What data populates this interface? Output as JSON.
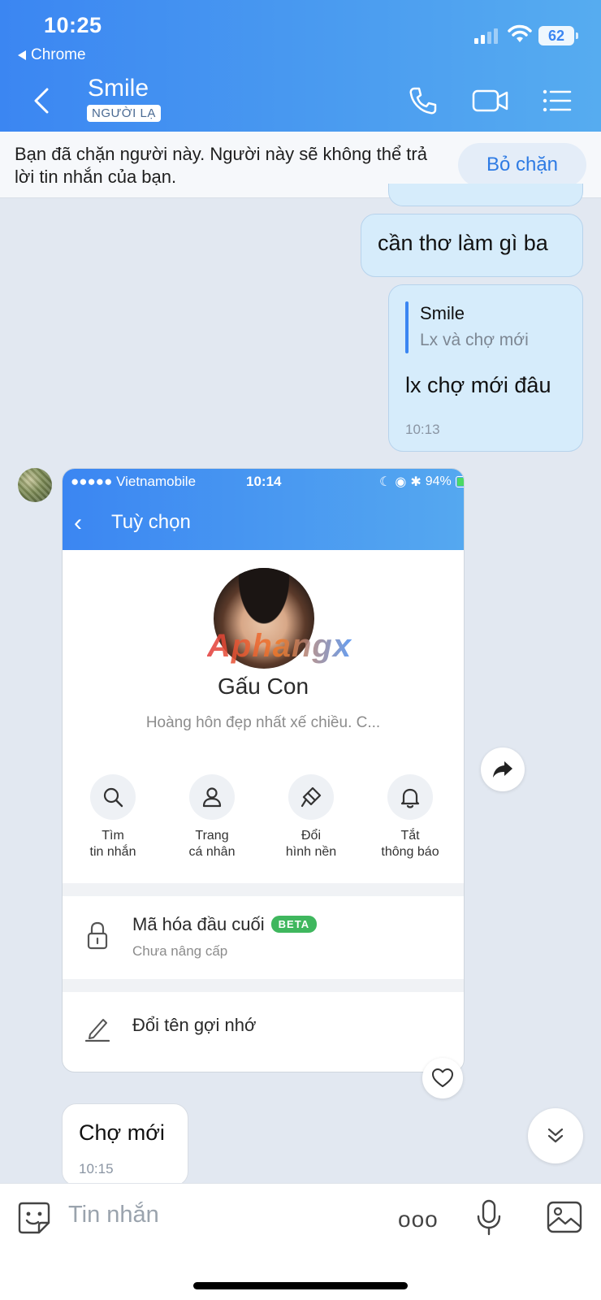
{
  "status_bar": {
    "time": "10:25",
    "back_app": "Chrome",
    "battery": "62"
  },
  "header": {
    "title": "Smile",
    "badge": "NGƯỜI LẠ",
    "icons": [
      "back-icon",
      "phone-icon",
      "video-icon",
      "list-menu-icon"
    ]
  },
  "block_banner": {
    "text": "Bạn đã chặn người này. Người này sẽ không thể trả lời tin nhắn của bạn.",
    "unblock_label": "Bỏ chặn"
  },
  "messages": {
    "out1": {
      "text": "cần thơ làm gì ba"
    },
    "out2": {
      "quote_author": "Smile",
      "quote_text": "Lx và chợ mới",
      "text": "lx chợ mới đâu",
      "time": "10:13"
    },
    "in_screenshot": {
      "status": {
        "carrier": "●●●●● Vietnamobile",
        "time": "10:14",
        "battery": "94%"
      },
      "title": "Tuỳ chọn",
      "watermark": "Aphangx",
      "profile_name": "Gấu Con",
      "profile_status": "Hoàng hôn đẹp nhất xế chiều.  C...",
      "quick_actions": [
        {
          "line1": "Tìm",
          "line2": "tin nhắn",
          "icon": "search-icon"
        },
        {
          "line1": "Trang",
          "line2": "cá nhân",
          "icon": "user-icon"
        },
        {
          "line1": "Đổi",
          "line2": "hình nền",
          "icon": "paint-brush-icon"
        },
        {
          "line1": "Tắt",
          "line2": "thông báo",
          "icon": "bell-icon"
        }
      ],
      "encryption": {
        "title": "Mã hóa đầu cuối",
        "badge": "BETA",
        "sub": "Chưa nâng cấp"
      },
      "rename": {
        "title": "Đổi tên gợi nhớ"
      }
    },
    "in2": {
      "text": "Chợ mới",
      "time": "10:15"
    }
  },
  "input_bar": {
    "placeholder": "Tin nhắn",
    "more": "ooo"
  },
  "colors": {
    "header_start": "#3b86f2",
    "header_end": "#56acf0",
    "out_bubble": "#d6ecfb",
    "accent": "#2e7be4",
    "beta": "#3fb75e"
  }
}
